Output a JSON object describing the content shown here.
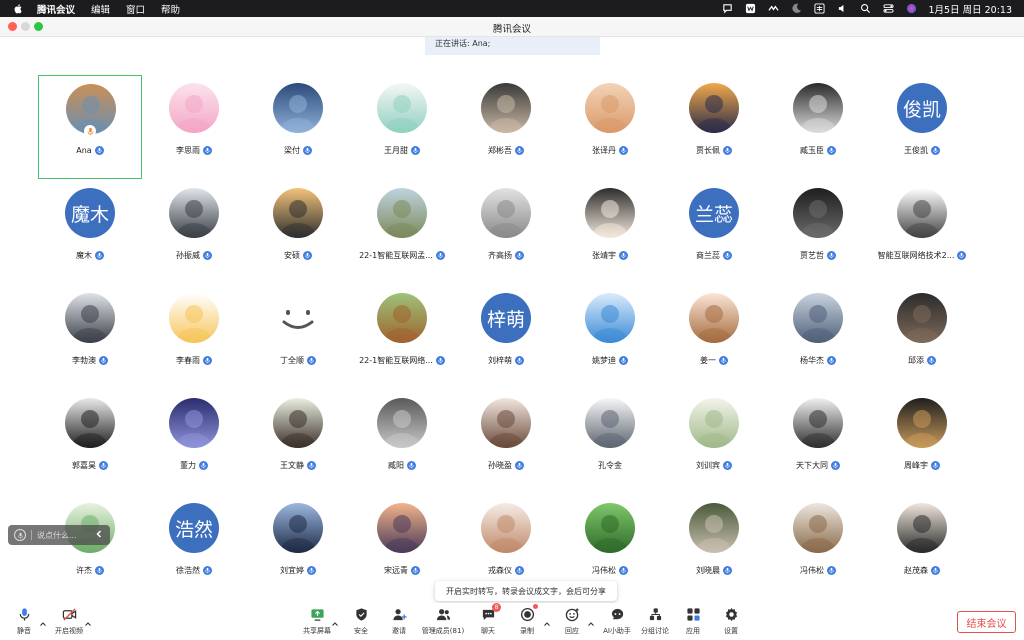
{
  "menubar": {
    "app_name": "腾讯会议",
    "items": [
      "编辑",
      "窗口",
      "帮助"
    ],
    "clock": "1月5日 周日  20:13"
  },
  "window": {
    "title": "腾讯会议"
  },
  "speaking": {
    "text": "正在讲话: Ana;"
  },
  "participants": [
    {
      "name": "Ana",
      "avatar": "photo",
      "tone": [
        "#c98f57",
        "#6b8fb0"
      ],
      "active": true,
      "speaking": true
    },
    {
      "name": "李思雨",
      "avatar": "photo",
      "tone": [
        "#fbe3ec",
        "#f4a6c6"
      ]
    },
    {
      "name": "梁付",
      "avatar": "photo",
      "tone": [
        "#2c4a7a",
        "#8fb1d9"
      ]
    },
    {
      "name": "王月甜",
      "avatar": "photo",
      "tone": [
        "#f6f6f6",
        "#8fd1c0"
      ]
    },
    {
      "name": "郑彬吾",
      "avatar": "photo",
      "tone": [
        "#3a3a3a",
        "#c9b8a4"
      ]
    },
    {
      "name": "张译丹",
      "avatar": "photo",
      "tone": [
        "#f3d3b7",
        "#d99a6a"
      ]
    },
    {
      "name": "贾长佩",
      "avatar": "photo",
      "tone": [
        "#f0a94a",
        "#2b2b4a"
      ]
    },
    {
      "name": "臧玉臣",
      "avatar": "photo",
      "tone": [
        "#2a2a2a",
        "#dcdcdc"
      ]
    },
    {
      "name": "王俊凯",
      "avatar": "text",
      "text": "俊凯"
    },
    {
      "name": "魔木",
      "avatar": "text",
      "text": "魔木"
    },
    {
      "name": "孙振威",
      "avatar": "photo",
      "tone": [
        "#dfe5ea",
        "#3a3f46"
      ]
    },
    {
      "name": "安硕",
      "avatar": "photo",
      "tone": [
        "#f2c37a",
        "#2f2f2f"
      ]
    },
    {
      "name": "22-1智能互联网孟...",
      "avatar": "photo",
      "tone": [
        "#bfd3e0",
        "#7b8a5a"
      ],
      "wide": true
    },
    {
      "name": "齐高扬",
      "avatar": "photo",
      "tone": [
        "#e2e2e2",
        "#8a8a8a"
      ]
    },
    {
      "name": "张靖宇",
      "avatar": "photo",
      "tone": [
        "#2d2d2d",
        "#f4e9dc"
      ]
    },
    {
      "name": "商兰蕊",
      "avatar": "text",
      "text": "兰蕊"
    },
    {
      "name": "贾艺哲",
      "avatar": "photo",
      "tone": [
        "#1e1e1e",
        "#6b6b6b"
      ]
    },
    {
      "name": "智能互联网络技术2...",
      "avatar": "photo",
      "tone": [
        "#ffffff",
        "#444444"
      ],
      "wide": true
    },
    {
      "name": "李勃澳",
      "avatar": "photo",
      "tone": [
        "#dfe3e8",
        "#3b4048"
      ]
    },
    {
      "name": "李春雨",
      "avatar": "photo",
      "tone": [
        "#ffffff",
        "#f6c55a"
      ]
    },
    {
      "name": "丁全顺",
      "avatar": "smile"
    },
    {
      "name": "22-1智能互联网络...",
      "avatar": "photo",
      "tone": [
        "#9dc37a",
        "#a0622e"
      ],
      "wide": true
    },
    {
      "name": "刘梓萌",
      "avatar": "text",
      "text": "梓萌"
    },
    {
      "name": "姚梦迪",
      "avatar": "photo",
      "tone": [
        "#d8ecfb",
        "#3c8ad6"
      ]
    },
    {
      "name": "姜一",
      "avatar": "photo",
      "tone": [
        "#fbe5d6",
        "#a56b3f"
      ]
    },
    {
      "name": "杨华杰",
      "avatar": "photo",
      "tone": [
        "#c9d2de",
        "#50607a"
      ]
    },
    {
      "name": "邱添",
      "avatar": "photo",
      "tone": [
        "#2b2b2b",
        "#7d6a5a"
      ]
    },
    {
      "name": "郭嘉昊",
      "avatar": "photo",
      "tone": [
        "#e9e9e9",
        "#202020"
      ]
    },
    {
      "name": "董力",
      "avatar": "photo",
      "tone": [
        "#2a2d6e",
        "#8f93d9"
      ]
    },
    {
      "name": "王文静",
      "avatar": "photo",
      "tone": [
        "#e9efe0",
        "#3b2f2a"
      ]
    },
    {
      "name": "臧阳",
      "avatar": "photo",
      "tone": [
        "#5a5a5a",
        "#c8c8c8"
      ]
    },
    {
      "name": "孙晓盈",
      "avatar": "photo",
      "tone": [
        "#f1e6df",
        "#6a4a3a"
      ]
    },
    {
      "name": "孔令金",
      "avatar": "photo",
      "tone": [
        "#f6f6f6",
        "#5d6572"
      ],
      "muted": false
    },
    {
      "name": "刘训宾",
      "avatar": "photo",
      "tone": [
        "#f3f3ea",
        "#9fb98a"
      ]
    },
    {
      "name": "天下大同",
      "avatar": "photo",
      "tone": [
        "#f0f0f0",
        "#2f2f2f"
      ]
    },
    {
      "name": "周峰宇",
      "avatar": "photo",
      "tone": [
        "#1f1f1f",
        "#c89a5a"
      ]
    },
    {
      "name": "许杰",
      "avatar": "photo",
      "tone": [
        "#e8f1df",
        "#6fae6a"
      ]
    },
    {
      "name": "徐浩然",
      "avatar": "text",
      "text": "浩然"
    },
    {
      "name": "刘宜婷",
      "avatar": "photo",
      "tone": [
        "#9bb7df",
        "#1f2b46"
      ]
    },
    {
      "name": "宋远青",
      "avatar": "photo",
      "tone": [
        "#f2b38a",
        "#4a3a5a"
      ]
    },
    {
      "name": "戎森仪",
      "avatar": "photo",
      "tone": [
        "#f4ece6",
        "#c08a6a"
      ]
    },
    {
      "name": "冯伟松",
      "avatar": "photo",
      "tone": [
        "#7ec86a",
        "#2f6a2a"
      ]
    },
    {
      "name": "刘晓晨",
      "avatar": "photo",
      "tone": [
        "#4a5a3a",
        "#c9c0b0"
      ]
    },
    {
      "name": "冯伟松",
      "avatar": "photo",
      "tone": [
        "#ece6df",
        "#8a6a4a"
      ]
    },
    {
      "name": "赵茂森",
      "avatar": "photo",
      "tone": [
        "#efe6dc",
        "#2a2a2a"
      ]
    }
  ],
  "voice_input": {
    "placeholder": "说点什么..."
  },
  "transcription_tip": {
    "text": "开启实时转写，转录会议成文字，会后可分享"
  },
  "toolbar": {
    "mute": "静音",
    "video": "开启视频",
    "share": "共享屏幕",
    "security": "安全",
    "invite": "邀请",
    "members": "管理成员(81)",
    "chat": "聊天",
    "chat_badge": "8",
    "record": "录制",
    "react": "回应",
    "ai": "AI小助手",
    "breakout": "分组讨论",
    "apps": "应用",
    "settings": "设置",
    "end": "结束会议"
  },
  "colors": {
    "accent_blue": "#3f7de0",
    "active_border": "#45c465",
    "end_red": "#e4504a",
    "text_avatar_bg": "#3d6fbf"
  }
}
